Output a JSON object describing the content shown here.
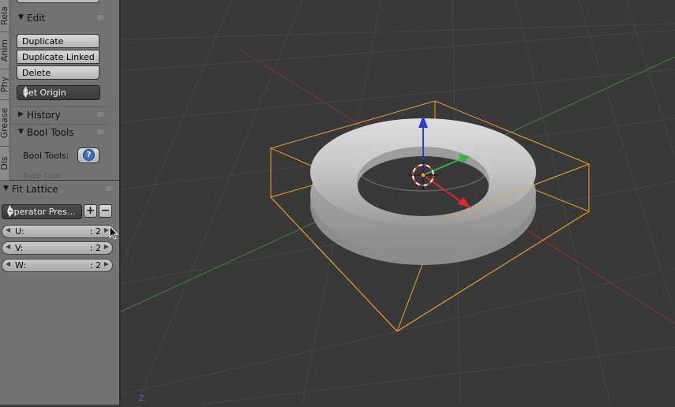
{
  "tabs": [
    "Rela",
    "Anim",
    "Phy",
    "Grease",
    "Dis"
  ],
  "tool_panel": {
    "edit": {
      "title": "Edit",
      "buttons": [
        "Duplicate",
        "Duplicate Linked",
        "Delete"
      ],
      "set_origin": "Set Origin"
    },
    "history": {
      "title": "History"
    },
    "bool_tools": {
      "title": "Bool Tools",
      "label": "Bool Tools:",
      "help": "?"
    },
    "cut_off_text": "Auto Dusl"
  },
  "fit_lattice": {
    "title": "Fit Lattice",
    "preset": "Operator Pres...",
    "add": "+",
    "remove": "−",
    "fields": [
      {
        "label": "U:",
        "value": ": 2"
      },
      {
        "label": "V:",
        "value": ": 2"
      },
      {
        "label": "W:",
        "value": ": 2"
      }
    ]
  },
  "viewport": {
    "axis_label": "Z",
    "colors": {
      "background": "#393939",
      "grid": "#4a4a4a",
      "x_axis": "#b03a3a",
      "y_axis": "#3c9a3c",
      "selection": "#f0a020",
      "gizmo_z": "#2a3cd6",
      "gizmo_y": "#2ab83a",
      "gizmo_x": "#d62a2a",
      "torus": "#c8c8c8"
    }
  }
}
